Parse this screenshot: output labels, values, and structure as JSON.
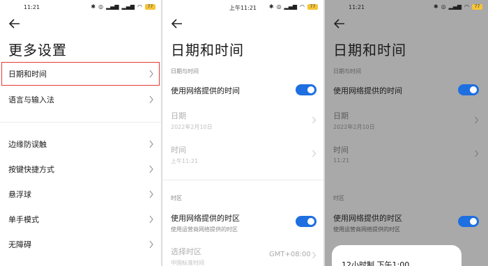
{
  "screen1": {
    "status_time": "11:21",
    "battery": "77",
    "title": "更多设置",
    "items": [
      {
        "label": "日期和时间"
      },
      {
        "label": "语言与输入法"
      },
      {
        "label": "边缘防误触"
      },
      {
        "label": "按键快捷方式"
      },
      {
        "label": "悬浮球"
      },
      {
        "label": "单手模式"
      },
      {
        "label": "无障碍"
      }
    ]
  },
  "screen2": {
    "status_time": "上午11:21",
    "battery": "77",
    "title": "日期和时间",
    "section_datetime": "日期与时间",
    "use_network_time": "使用网络提供的时间",
    "date_label": "日期",
    "date_value": "2022年2月10日",
    "time_label": "时间",
    "time_value": "上午11:21",
    "section_timezone": "时区",
    "use_network_tz": "使用网络提供的时区",
    "use_network_tz_sub": "使用运营商网络提供的时区",
    "select_tz": "选择时区",
    "select_tz_sub": "中国标准时间",
    "gmt": "GMT+08:00"
  },
  "screen3": {
    "status_time": "11:21",
    "battery": "77",
    "title": "日期和时间",
    "section_datetime": "日期与时间",
    "use_network_time": "使用网络提供的时间",
    "date_label": "日期",
    "date_value": "2022年2月10日",
    "time_label": "时间",
    "time_value": "11:21",
    "section_timezone": "时区",
    "use_network_tz": "使用网络提供的时区",
    "use_network_tz_sub": "使用运营商网络提供的时区",
    "sheet_text": "12小时制 下午1:00"
  },
  "colors": {
    "accent": "#1e6fe0",
    "highlight": "#e53935",
    "battery": "#f5c338",
    "dim_overlay": "#a9a9a9"
  }
}
